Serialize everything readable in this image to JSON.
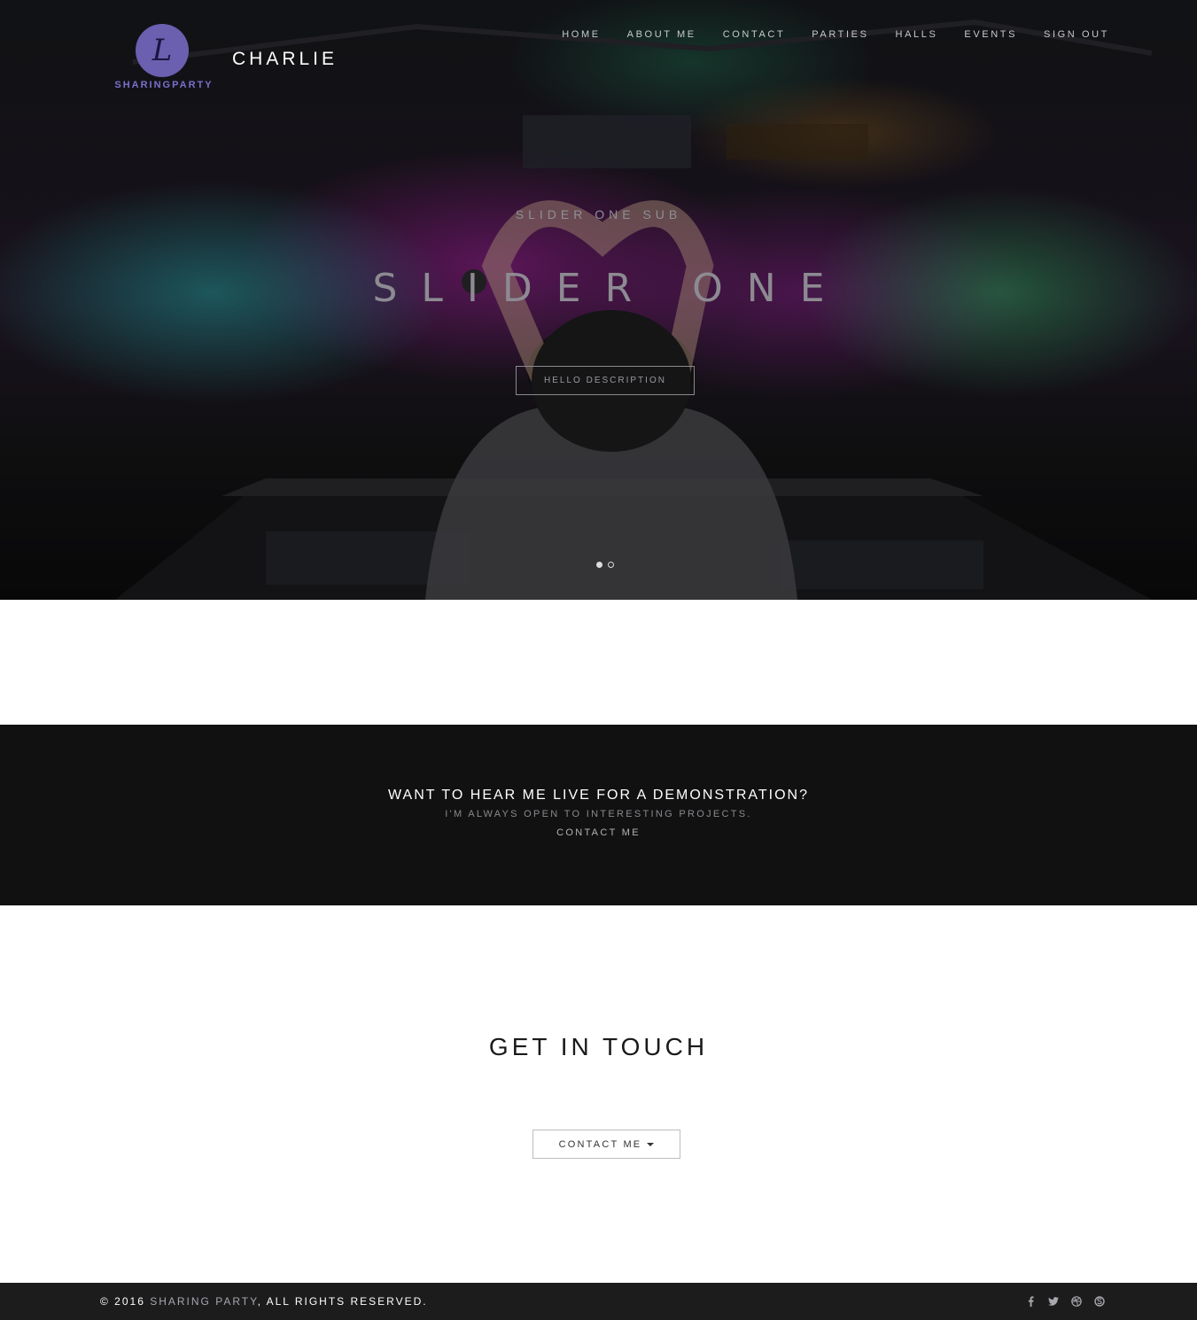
{
  "header": {
    "logo_text": "SHARINGPARTY",
    "logo_letter": "L",
    "brand": "CHARLIE",
    "nav": [
      {
        "label": "HOME"
      },
      {
        "label": "ABOUT ME"
      },
      {
        "label": "CONTACT"
      },
      {
        "label": "PARTIES"
      },
      {
        "label": "HALLS"
      },
      {
        "label": "EVENTS"
      },
      {
        "label": "SIGN OUT"
      }
    ]
  },
  "hero": {
    "subtitle": "SLIDER ONE SUB",
    "title": "SLIDER ONE",
    "button_label": "HELLO DESCRIPTION",
    "slide_count": 2,
    "active_slide": 1
  },
  "band": {
    "title": "WANT TO HEAR ME LIVE FOR A DEMONSTRATION?",
    "subtitle": "I'M ALWAYS OPEN TO INTERESTING PROJECTS.",
    "link": "CONTACT ME"
  },
  "touch": {
    "title": "GET IN TOUCH",
    "button_label": "CONTACT ME"
  },
  "footer": {
    "copy_prefix": "© 2016 ",
    "copy_brand": "SHARING PARTY",
    "copy_suffix": ", ALL RIGHTS RESERVED.",
    "social": [
      "facebook-icon",
      "twitter-icon",
      "dribbble-icon",
      "skype-icon"
    ]
  },
  "colors": {
    "accent": "#6b5fb0",
    "dark_band": "#111112",
    "footer_bg": "#1c1c1d"
  }
}
